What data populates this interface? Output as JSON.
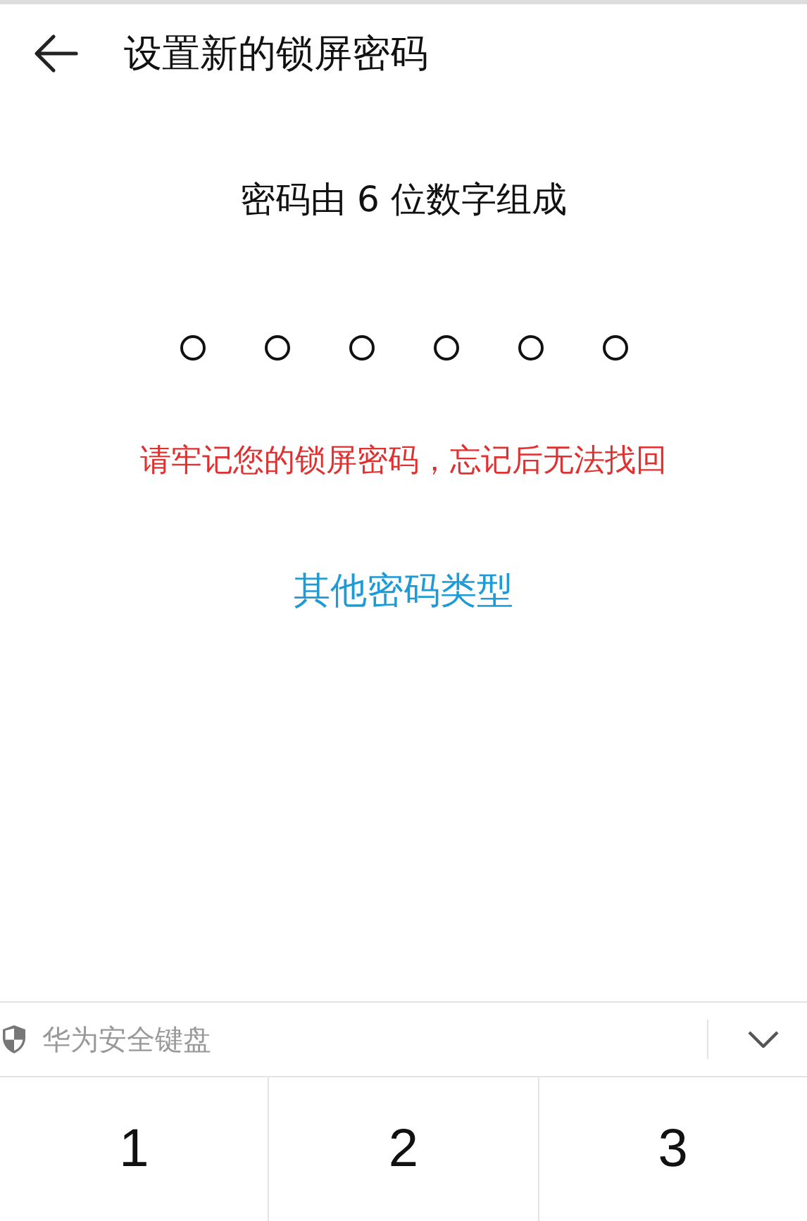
{
  "header": {
    "title": "设置新的锁屏密码"
  },
  "prompt": "密码由 6 位数字组成",
  "pin_dots": [
    {
      "filled": false
    },
    {
      "filled": false
    },
    {
      "filled": false
    },
    {
      "filled": false
    },
    {
      "filled": false
    },
    {
      "filled": false
    }
  ],
  "warning": "请牢记您的锁屏密码，忘记后无法找回",
  "other_types_link": "其他密码类型",
  "keyboard": {
    "title": "华为安全键盘",
    "keys": [
      "1",
      "2",
      "3"
    ]
  }
}
